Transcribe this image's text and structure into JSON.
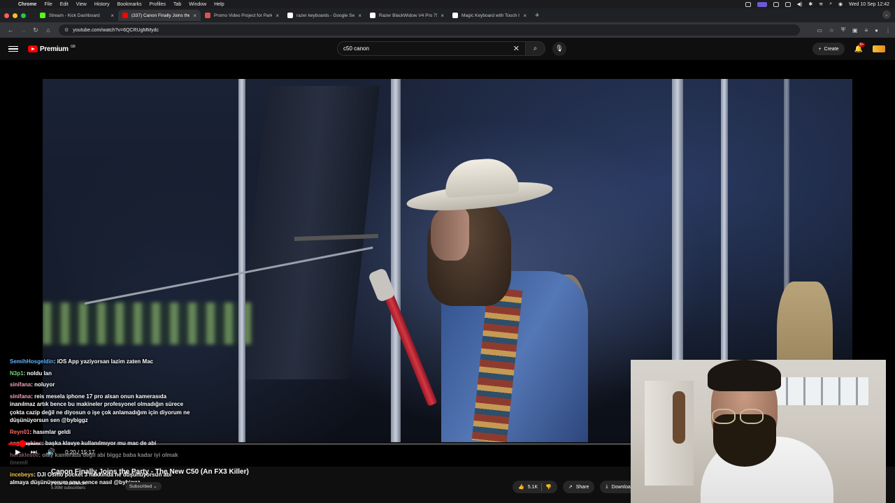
{
  "menubar": {
    "app": "Chrome",
    "items": [
      "File",
      "Edit",
      "View",
      "History",
      "Bookmarks",
      "Profiles",
      "Tab",
      "Window",
      "Help"
    ],
    "datetime": "Wed 10 Sep  12:42"
  },
  "tabs": [
    {
      "title": "Stream - Kick Dashboard",
      "favicon_color": "#53fc18",
      "active": false
    },
    {
      "title": "(337) Canon Finally Joins the",
      "favicon_color": "#ff0000",
      "active": true
    },
    {
      "title": "Promo Video Project for Park",
      "favicon_color": "#d9534f",
      "active": false
    },
    {
      "title": "razer keyboards - Google Se",
      "favicon_color": "#ffffff",
      "active": false
    },
    {
      "title": "Razer BlackWidow V4 Pro 75",
      "favicon_color": "#ffffff",
      "active": false
    },
    {
      "title": "Magic Keyboard with Touch I",
      "favicon_color": "#ffffff",
      "active": false
    }
  ],
  "address": {
    "url": "youtube.com/watch?v=6QCRUgMMydc"
  },
  "youtube": {
    "logo_text": "Premium",
    "country": "GB",
    "search_value": "c50 canon",
    "create_label": "Create",
    "notification_count": "9+"
  },
  "player": {
    "time": "0:20 / 15:17",
    "progress_fraction": 0.022,
    "buffered_fraction": 0.05
  },
  "chat": [
    {
      "user": "SemihHosgeldin",
      "color": "blue",
      "text": "iOS App yaziyorsan lazim zaten Mac"
    },
    {
      "user": "N3p1",
      "color": "green",
      "text": "noldu lan"
    },
    {
      "user": "sinifana",
      "color": "pink",
      "text": "noluyor"
    },
    {
      "user": "sinifana",
      "color": "pink",
      "text": "reis mesela iphone 17 pro alsan onun kamerasıda inanılmaz artık bence bu makineler profesyonel olmadığın sürece çokta cazip değil ne diyosun o işe çok anlamadığım için diyorum ne düşünüyorsun sen @bybiggz"
    },
    {
      "user": "Reyn01",
      "color": "red",
      "text": "hasımlar geldi"
    },
    {
      "user": "cagataykinc",
      "color": "pink",
      "text": "başka klavye kullanılmıyor mu mac de abi"
    },
    {
      "user": "herakles00",
      "color": "pink",
      "text": "olay kamerada değil abi biggz baba kadar iyi olmak önemli"
    },
    {
      "user": "incebeys",
      "color": "yellow",
      "text": "DJI Osmo pocket 3 hakkında ne düşünüyorsun abi almaya düşünüyorum ama sence nasıl @bybiggz"
    }
  ],
  "video": {
    "title": "Canon Finally Joins the Party - The New C50 (An FX3 Killer)",
    "channel": "Peter McKinnon",
    "subscribers": "5.99M subscribers",
    "subscribed_label": "Subscribed",
    "likes": "5.1K",
    "share_label": "Share",
    "download_label": "Download"
  }
}
